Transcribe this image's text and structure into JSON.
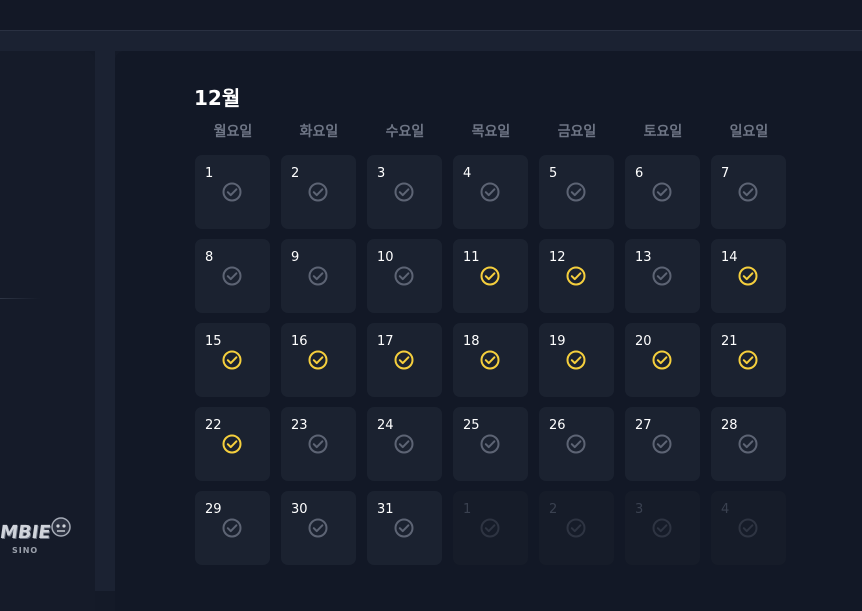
{
  "logo": {
    "text": "MBIE",
    "subtext": "SINO"
  },
  "calendar": {
    "month_title": "12월",
    "weekdays": [
      "월요일",
      "화요일",
      "수요일",
      "목요일",
      "금요일",
      "토요일",
      "일요일"
    ],
    "days": [
      {
        "label": "1",
        "checked": false,
        "outside": false
      },
      {
        "label": "2",
        "checked": false,
        "outside": false
      },
      {
        "label": "3",
        "checked": false,
        "outside": false
      },
      {
        "label": "4",
        "checked": false,
        "outside": false
      },
      {
        "label": "5",
        "checked": false,
        "outside": false
      },
      {
        "label": "6",
        "checked": false,
        "outside": false
      },
      {
        "label": "7",
        "checked": false,
        "outside": false
      },
      {
        "label": "8",
        "checked": false,
        "outside": false
      },
      {
        "label": "9",
        "checked": false,
        "outside": false
      },
      {
        "label": "10",
        "checked": false,
        "outside": false
      },
      {
        "label": "11",
        "checked": true,
        "outside": false
      },
      {
        "label": "12",
        "checked": true,
        "outside": false
      },
      {
        "label": "13",
        "checked": false,
        "outside": false
      },
      {
        "label": "14",
        "checked": true,
        "outside": false
      },
      {
        "label": "15",
        "checked": true,
        "outside": false
      },
      {
        "label": "16",
        "checked": true,
        "outside": false
      },
      {
        "label": "17",
        "checked": true,
        "outside": false
      },
      {
        "label": "18",
        "checked": true,
        "outside": false
      },
      {
        "label": "19",
        "checked": true,
        "outside": false
      },
      {
        "label": "20",
        "checked": true,
        "outside": false
      },
      {
        "label": "21",
        "checked": true,
        "outside": false
      },
      {
        "label": "22",
        "checked": true,
        "outside": false
      },
      {
        "label": "23",
        "checked": false,
        "outside": false
      },
      {
        "label": "24",
        "checked": false,
        "outside": false
      },
      {
        "label": "25",
        "checked": false,
        "outside": false
      },
      {
        "label": "26",
        "checked": false,
        "outside": false
      },
      {
        "label": "27",
        "checked": false,
        "outside": false
      },
      {
        "label": "28",
        "checked": false,
        "outside": false
      },
      {
        "label": "29",
        "checked": false,
        "outside": false
      },
      {
        "label": "30",
        "checked": false,
        "outside": false
      },
      {
        "label": "31",
        "checked": false,
        "outside": false
      },
      {
        "label": "1",
        "checked": false,
        "outside": true
      },
      {
        "label": "2",
        "checked": false,
        "outside": true
      },
      {
        "label": "3",
        "checked": false,
        "outside": true
      },
      {
        "label": "4",
        "checked": false,
        "outside": true
      }
    ]
  },
  "colors": {
    "checked": "#f5cf3d",
    "unchecked": "#5d6474",
    "outside": "#2e3442"
  },
  "icons": {
    "day_status": "check-circle-icon"
  }
}
